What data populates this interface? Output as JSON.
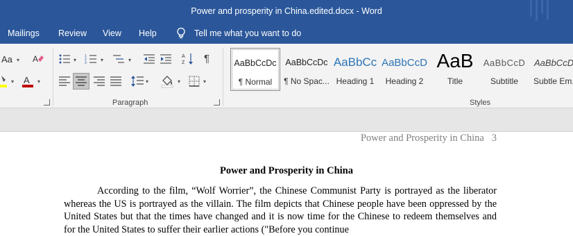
{
  "window": {
    "title": "Power and prosperity in China.edited.docx  -  Word"
  },
  "tabs": [
    {
      "label": "Mailings"
    },
    {
      "label": "Review"
    },
    {
      "label": "View"
    },
    {
      "label": "Help"
    }
  ],
  "tell_me": {
    "label": "Tell me what you want to do"
  },
  "ribbon": {
    "font_group": {
      "change_case_label": "Aa"
    },
    "paragraph_group": {
      "label": "Paragraph"
    },
    "styles_group": {
      "label": "Styles",
      "items": [
        {
          "preview": "AaBbCcDc",
          "name": "¶ Normal",
          "selected": true,
          "color": "#222222"
        },
        {
          "preview": "AaBbCcDc",
          "name": "¶ No Spac...",
          "selected": false,
          "color": "#222222"
        },
        {
          "preview": "AaBbCc",
          "name": "Heading 1",
          "selected": false,
          "color": "#2e74b5"
        },
        {
          "preview": "AaBbCcD",
          "name": "Heading 2",
          "selected": false,
          "color": "#2e74b5"
        },
        {
          "preview": "AaB",
          "name": "Title",
          "selected": false,
          "color": "#000000"
        },
        {
          "preview": "AaBbCcD",
          "name": "Subtitle",
          "selected": false,
          "color": "#595959"
        },
        {
          "preview": "AaBbCcD",
          "name": "Subtle Em...",
          "selected": false,
          "color": "#404040"
        }
      ]
    }
  },
  "document": {
    "header": "Power and Prosperity in China   3",
    "title": "Power and Prosperity in China",
    "paragraph": "According to the film, “Wolf Worrier”, the Chinese Communist Party is portrayed as the liberator whereas the US is portrayed as the villain. The film depicts that Chinese people have been oppressed by the United States but that the times have changed and it is now time for the Chinese to redeem themselves and for the United States to suffer their earlier actions (\"Before you continue"
  },
  "colors": {
    "titlebar": "#2b579a",
    "ribbon": "#f3f3f3",
    "font_color_red": "#c00000",
    "highlight_yellow": "#ffff00"
  }
}
